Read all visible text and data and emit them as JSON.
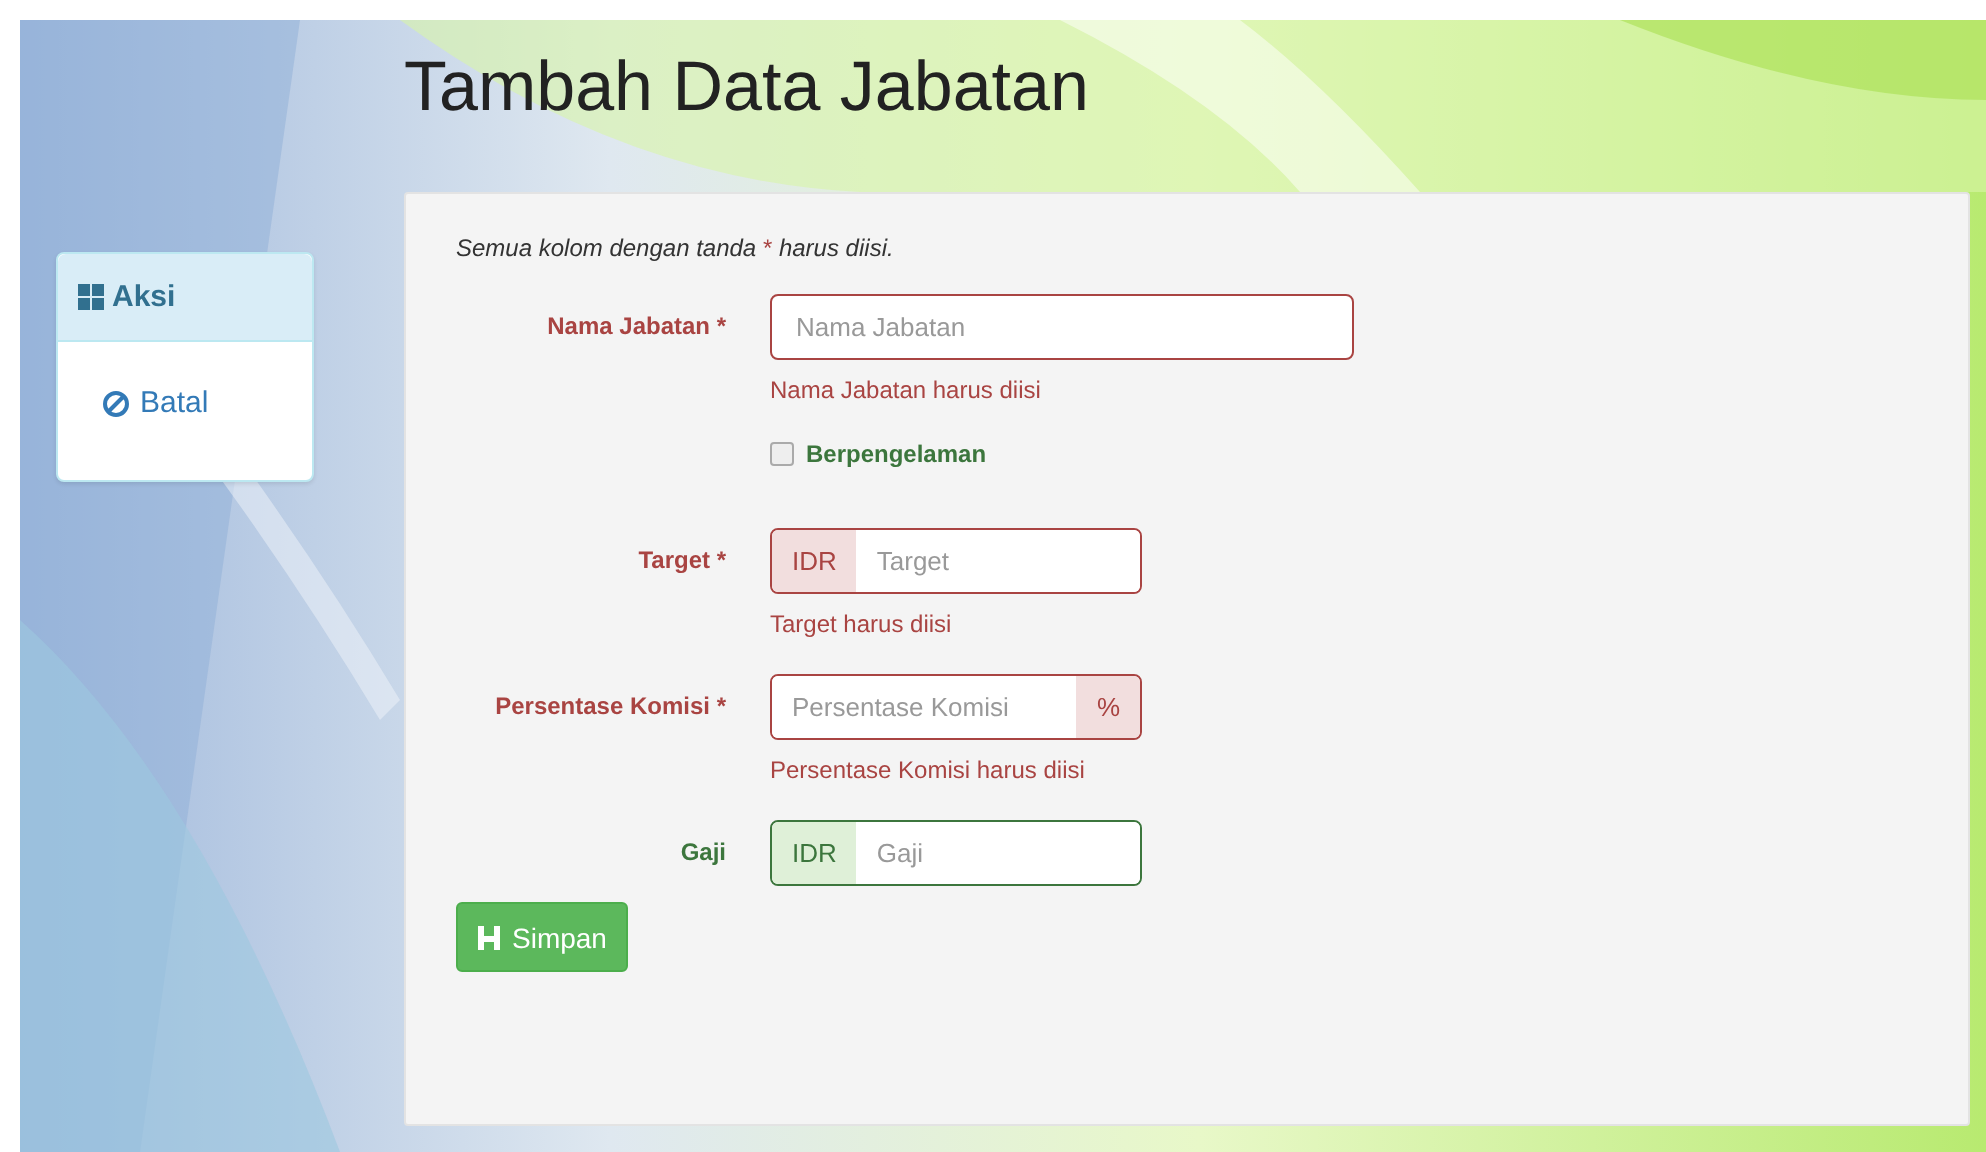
{
  "page_title": "Tambah Data Jabatan",
  "sidebar": {
    "heading": "Aksi",
    "items": [
      {
        "label": "Batal"
      }
    ]
  },
  "form": {
    "note": {
      "before": "Semua kolom dengan tanda ",
      "mark": "*",
      "after": " harus diisi."
    },
    "fields": [
      {
        "kind": "text",
        "label": "Nama Jabatan *",
        "placeholder": "Nama Jabatan",
        "invalid": true,
        "error": "Nama Jabatan harus diisi"
      },
      {
        "kind": "checkbox",
        "label": "Berpengelaman",
        "checked": false,
        "invalid": false
      },
      {
        "kind": "prefix",
        "label": "Target *",
        "addon": "IDR",
        "placeholder": "Target",
        "invalid": true,
        "error": "Target harus diisi"
      },
      {
        "kind": "suffix",
        "label": "Persentase Komisi *",
        "addon": "%",
        "placeholder": "Persentase Komisi",
        "invalid": true,
        "error": "Persentase Komisi harus diisi"
      },
      {
        "kind": "prefix",
        "label": "Gaji",
        "addon": "IDR",
        "placeholder": "Gaji",
        "invalid": false
      }
    ],
    "submit": {
      "label": "Simpan"
    }
  }
}
